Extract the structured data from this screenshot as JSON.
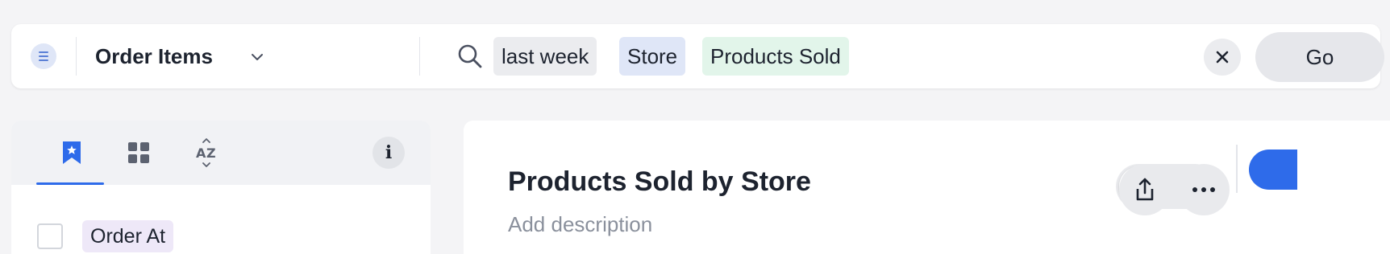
{
  "search_bar": {
    "source_name": "Order Items",
    "tokens": [
      {
        "text": "last week",
        "kind": "time"
      },
      {
        "text": "Store",
        "kind": "attribute"
      },
      {
        "text": "Products Sold",
        "kind": "measure"
      }
    ],
    "go_label": "Go",
    "icons": {
      "source": "datasource-icon",
      "dropdown": "chevron-down-icon",
      "search": "search-icon",
      "clear": "close-icon"
    }
  },
  "left_panel": {
    "tabs": [
      {
        "icon": "bookmark-icon",
        "active": true
      },
      {
        "icon": "grid-icon",
        "active": false
      },
      {
        "icon": "sort-az-icon",
        "active": false
      }
    ],
    "info_label": "i",
    "columns": [
      {
        "label": "Order At",
        "checked": false
      }
    ]
  },
  "answer": {
    "title": "Products Sold by Store",
    "description_placeholder": "Add description",
    "toolbar": {
      "views": [
        {
          "icon": "table-icon",
          "active": true
        },
        {
          "icon": "bar-chart-icon",
          "active": false
        }
      ],
      "share_icon": "share-icon",
      "more_icon": "more-horizontal-icon"
    }
  },
  "colors": {
    "accent": "#2e6bea",
    "time_token": "#ebecef",
    "attribute_token": "#dfe6f7",
    "measure_token": "#e2f5ea",
    "column_chip": "#eee8f8",
    "page_bg": "#f4f4f6"
  }
}
